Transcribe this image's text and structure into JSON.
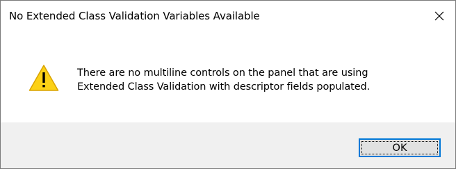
{
  "window": {
    "title": "No Extended Class Validation Variables Available",
    "close_icon": "close-icon"
  },
  "message": {
    "icon": "warning-icon",
    "line1": "There are no multiline controls on the panel that are using",
    "line2": "Extended Class Validation with descriptor fields populated."
  },
  "buttons": {
    "ok_label": "OK"
  },
  "colors": {
    "warning_fill": "#fcd116",
    "focus_border": "#0078d7",
    "footer_bg": "#f0f0f0",
    "button_bg": "#e1e1e1"
  }
}
